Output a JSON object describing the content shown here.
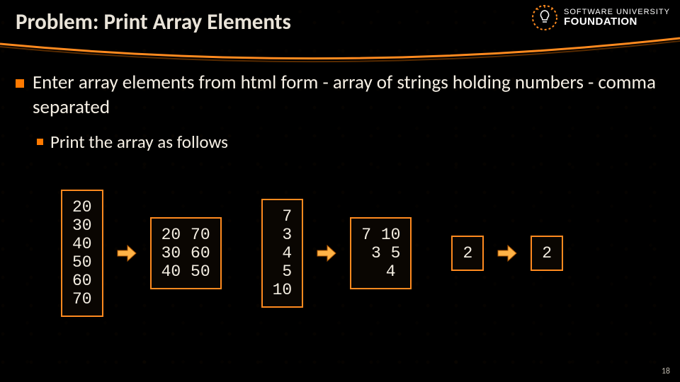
{
  "header": {
    "title": "Problem: Print Array Elements",
    "logo": {
      "line1": "SOFTWARE UNIVERSITY",
      "line2": "FOUNDATION"
    }
  },
  "bullets": {
    "b1": "Enter array elements from html form - array of strings holding numbers - comma separated",
    "b2": "Print the array as follows"
  },
  "examples": {
    "in1": "20\n30\n40\n50\n60\n70",
    "out1": "20 70\n30 60\n40 50",
    "in2": " 7\n 3\n 4\n 5\n10",
    "out2": "7 10\n 3 5\n  4",
    "in3": "2",
    "out3": "2"
  },
  "page_number": "18",
  "colors": {
    "accent": "#ff7a00",
    "border": "#ff8a1f",
    "text": "#f5efe4"
  }
}
